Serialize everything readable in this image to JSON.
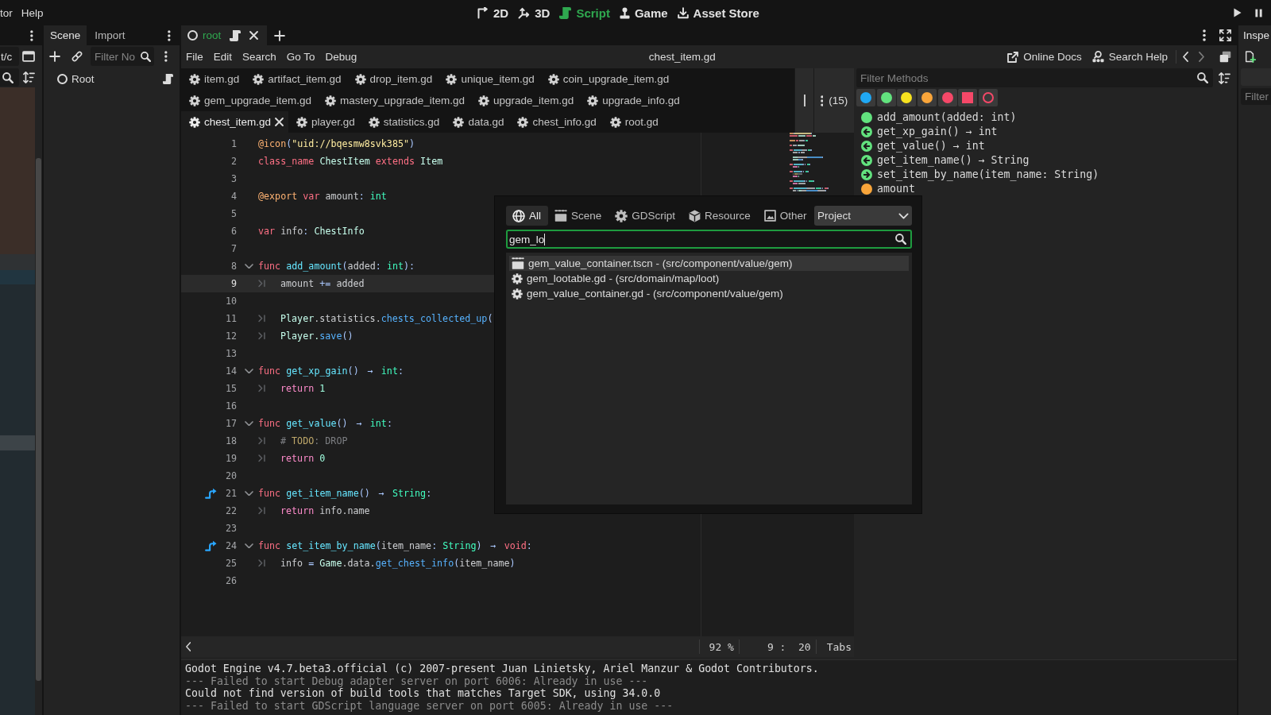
{
  "top_bar": {
    "menu": [
      "tor",
      "Help"
    ],
    "main_screens": [
      {
        "label": "2D",
        "selected": false
      },
      {
        "label": "3D",
        "selected": false
      },
      {
        "label": "Script",
        "selected": true
      },
      {
        "label": "Game",
        "selected": false
      },
      {
        "label": "Asset Store",
        "selected": false
      }
    ]
  },
  "filesystem_dock": {
    "path": "t/c"
  },
  "scene_dock": {
    "tabs": [
      {
        "label": "Scene",
        "selected": true
      },
      {
        "label": "Import",
        "selected": false
      }
    ],
    "filter": {
      "placeholder": "Filter No"
    },
    "tree": [
      {
        "label": "Root",
        "script_attached": true
      }
    ]
  },
  "scene_tabs": [
    {
      "label": "root",
      "selected": true,
      "script_attached": true
    }
  ],
  "script_editor": {
    "menu": [
      "File",
      "Edit",
      "Search",
      "Go To",
      "Debug"
    ],
    "title": "chest_item.gd",
    "help_links": [
      "Online Docs",
      "Search Help"
    ],
    "script_tab_rows": [
      [
        {
          "label": "item.gd",
          "selected": false
        },
        {
          "label": "artifact_item.gd",
          "selected": false
        },
        {
          "label": "drop_item.gd",
          "selected": false
        },
        {
          "label": "unique_item.gd",
          "selected": false
        },
        {
          "label": "coin_upgrade_item.gd",
          "selected": false
        }
      ],
      [
        {
          "label": "gem_upgrade_item.gd",
          "selected": false
        },
        {
          "label": "mastery_upgrade_item.gd",
          "selected": false
        },
        {
          "label": "upgrade_item.gd",
          "selected": false
        },
        {
          "label": "upgrade_info.gd",
          "selected": false
        }
      ],
      [
        {
          "label": "chest_item.gd",
          "selected": true
        },
        {
          "label": "player.gd",
          "selected": false
        },
        {
          "label": "statistics.gd",
          "selected": false
        },
        {
          "label": "data.gd",
          "selected": false
        },
        {
          "label": "chest_info.gd",
          "selected": false
        },
        {
          "label": "root.gd",
          "selected": false
        }
      ]
    ],
    "tab_count": "(15)",
    "code_lines": [
      {
        "number": "1",
        "indented": false,
        "foldable": false,
        "override": false,
        "current": false,
        "tokens": [
          {
            "kind": "annotation",
            "text": "@icon"
          },
          {
            "kind": "symbol",
            "text": "("
          },
          {
            "kind": "string",
            "text": "\"uid://bqesmw8svk385\""
          },
          {
            "kind": "symbol",
            "text": ")"
          }
        ]
      },
      {
        "number": "2",
        "indented": false,
        "foldable": false,
        "override": false,
        "current": false,
        "tokens": [
          {
            "kind": "keyword",
            "text": "class_name"
          },
          {
            "kind": "class",
            "text": " ChestItem"
          },
          {
            "kind": "keyword",
            "text": " extends"
          },
          {
            "kind": "class",
            "text": " Item"
          }
        ]
      },
      {
        "number": "3",
        "indented": false,
        "foldable": false,
        "override": false,
        "current": false
      },
      {
        "number": "4",
        "indented": false,
        "foldable": false,
        "override": false,
        "current": false,
        "tokens": [
          {
            "kind": "annotation",
            "text": "@export"
          },
          {
            "kind": "keyword",
            "text": " var"
          },
          {
            "kind": "text",
            "text": " amount"
          },
          {
            "kind": "symbol",
            "text": ": "
          },
          {
            "kind": "type",
            "text": "int"
          }
        ]
      },
      {
        "number": "5",
        "indented": false,
        "foldable": false,
        "override": false,
        "current": false
      },
      {
        "number": "6",
        "indented": false,
        "foldable": false,
        "override": false,
        "current": false,
        "tokens": [
          {
            "kind": "keyword",
            "text": "var"
          },
          {
            "kind": "text",
            "text": " info"
          },
          {
            "kind": "symbol",
            "text": ": "
          },
          {
            "kind": "class",
            "text": "ChestInfo"
          }
        ]
      },
      {
        "number": "7",
        "indented": false,
        "foldable": false,
        "override": false,
        "current": false
      },
      {
        "number": "8",
        "indented": false,
        "foldable": true,
        "override": false,
        "current": false,
        "tokens": [
          {
            "kind": "keyword",
            "text": "func"
          },
          {
            "kind": "function",
            "text": " add_amount"
          },
          {
            "kind": "symbol",
            "text": "("
          },
          {
            "kind": "text",
            "text": "added"
          },
          {
            "kind": "symbol",
            "text": ": "
          },
          {
            "kind": "type",
            "text": "int"
          },
          {
            "kind": "symbol",
            "text": "):"
          }
        ]
      },
      {
        "number": "9",
        "indented": true,
        "foldable": false,
        "override": false,
        "current": true,
        "tokens": [
          {
            "kind": "text",
            "text": "amount "
          },
          {
            "kind": "symbol",
            "text": "+="
          },
          {
            "kind": "text",
            "text": " added"
          }
        ]
      },
      {
        "number": "10",
        "indented": false,
        "foldable": false,
        "override": false,
        "current": false
      },
      {
        "number": "11",
        "indented": true,
        "foldable": false,
        "override": false,
        "current": false,
        "tokens": [
          {
            "kind": "class",
            "text": "Player"
          },
          {
            "kind": "text",
            "text": ".statistics."
          },
          {
            "kind": "call",
            "text": "chests_collected_up"
          },
          {
            "kind": "symbol",
            "text": "("
          }
        ]
      },
      {
        "number": "12",
        "indented": true,
        "foldable": false,
        "override": false,
        "current": false,
        "tokens": [
          {
            "kind": "class",
            "text": "Player."
          },
          {
            "kind": "call",
            "text": "save"
          },
          {
            "kind": "symbol",
            "text": "()"
          }
        ]
      },
      {
        "number": "13",
        "indented": false,
        "foldable": false,
        "override": false,
        "current": false
      },
      {
        "number": "14",
        "indented": false,
        "foldable": true,
        "override": false,
        "current": false,
        "tokens": [
          {
            "kind": "keyword",
            "text": "func"
          },
          {
            "kind": "function",
            "text": " get_xp_gain"
          },
          {
            "kind": "symbol",
            "text": "() "
          },
          {
            "kind": "arrow",
            "text": "→"
          },
          {
            "kind": "type",
            "text": " int"
          },
          {
            "kind": "symbol",
            "text": ":"
          }
        ]
      },
      {
        "number": "15",
        "indented": true,
        "foldable": false,
        "override": false,
        "current": false,
        "tokens": [
          {
            "kind": "control",
            "text": "return"
          },
          {
            "kind": "number",
            "text": " 1"
          }
        ]
      },
      {
        "number": "16",
        "indented": false,
        "foldable": false,
        "override": false,
        "current": false
      },
      {
        "number": "17",
        "indented": false,
        "foldable": true,
        "override": false,
        "current": false,
        "tokens": [
          {
            "kind": "keyword",
            "text": "func"
          },
          {
            "kind": "function",
            "text": " get_value"
          },
          {
            "kind": "symbol",
            "text": "() "
          },
          {
            "kind": "arrow",
            "text": "→"
          },
          {
            "kind": "type",
            "text": " int"
          },
          {
            "kind": "symbol",
            "text": ":"
          }
        ]
      },
      {
        "number": "18",
        "indented": true,
        "foldable": false,
        "override": false,
        "current": false,
        "tokens": [
          {
            "kind": "comment",
            "text": "# "
          },
          {
            "kind": "todo",
            "text": "TODO"
          },
          {
            "kind": "comment",
            "text": ": DROP"
          }
        ]
      },
      {
        "number": "19",
        "indented": true,
        "foldable": false,
        "override": false,
        "current": false,
        "tokens": [
          {
            "kind": "control",
            "text": "return"
          },
          {
            "kind": "number",
            "text": " 0"
          }
        ]
      },
      {
        "number": "20",
        "indented": false,
        "foldable": false,
        "override": false,
        "current": false
      },
      {
        "number": "21",
        "indented": false,
        "foldable": true,
        "override": true,
        "current": false,
        "tokens": [
          {
            "kind": "keyword",
            "text": "func"
          },
          {
            "kind": "function",
            "text": " get_item_name"
          },
          {
            "kind": "symbol",
            "text": "() "
          },
          {
            "kind": "arrow",
            "text": "→"
          },
          {
            "kind": "type",
            "text": " String"
          },
          {
            "kind": "symbol",
            "text": ":"
          }
        ]
      },
      {
        "number": "22",
        "indented": true,
        "foldable": false,
        "override": false,
        "current": false,
        "tokens": [
          {
            "kind": "control",
            "text": "return"
          },
          {
            "kind": "text",
            "text": " info.name"
          }
        ]
      },
      {
        "number": "23",
        "indented": false,
        "foldable": false,
        "override": false,
        "current": false
      },
      {
        "number": "24",
        "indented": false,
        "foldable": true,
        "override": true,
        "current": false,
        "tokens": [
          {
            "kind": "keyword",
            "text": "func"
          },
          {
            "kind": "function",
            "text": " set_item_by_name"
          },
          {
            "kind": "symbol",
            "text": "("
          },
          {
            "kind": "text",
            "text": "item_name"
          },
          {
            "kind": "symbol",
            "text": ": "
          },
          {
            "kind": "type",
            "text": "String"
          },
          {
            "kind": "symbol",
            "text": ") "
          },
          {
            "kind": "arrow",
            "text": "→"
          },
          {
            "kind": "keyword",
            "text": " void"
          },
          {
            "kind": "symbol",
            "text": ":"
          }
        ]
      },
      {
        "number": "25",
        "indented": true,
        "foldable": false,
        "override": false,
        "current": false,
        "tokens": [
          {
            "kind": "text",
            "text": "info "
          },
          {
            "kind": "symbol",
            "text": "="
          },
          {
            "kind": "class",
            "text": " Game"
          },
          {
            "kind": "text",
            "text": ".data."
          },
          {
            "kind": "call",
            "text": "get_chest_info"
          },
          {
            "kind": "symbol",
            "text": "("
          },
          {
            "kind": "text",
            "text": "item_name"
          },
          {
            "kind": "symbol",
            "text": ")"
          }
        ]
      },
      {
        "number": "26",
        "indented": false,
        "foldable": false,
        "override": false,
        "current": false
      }
    ],
    "zoom": "92 %",
    "cursor": "9 :  20",
    "indentation": "Tabs"
  },
  "methods_panel": {
    "filter": {
      "placeholder": "Filter Methods"
    },
    "color_filters": [
      {
        "kind": "circle",
        "color": "#20a8f4"
      },
      {
        "kind": "circle",
        "color": "#62e27e"
      },
      {
        "kind": "circle",
        "color": "#f7e21f"
      },
      {
        "kind": "circle",
        "color": "#f9a53a"
      },
      {
        "kind": "circle",
        "color": "#f54868"
      },
      {
        "kind": "square",
        "color": "#f54868"
      },
      {
        "kind": "ring",
        "color": "#f54868"
      }
    ],
    "members": [
      {
        "label": "add_amount(added: int)",
        "kind": "plain",
        "color": "#62e27e"
      },
      {
        "label": "get_xp_gain() → int",
        "kind": "getter",
        "color": "#62e27e"
      },
      {
        "label": "get_value() → int",
        "kind": "getter",
        "color": "#62e27e"
      },
      {
        "label": "get_item_name() → String",
        "kind": "getter",
        "color": "#62e27e"
      },
      {
        "label": "set_item_by_name(item_name: String)",
        "kind": "setter",
        "color": "#62e27e"
      },
      {
        "label": "amount",
        "kind": "plain",
        "color": "#f9a53a"
      }
    ]
  },
  "output": [
    {
      "text": "Godot Engine v4.7.beta3.official (c) 2007-present Juan Linietsky, Ariel Manzur & Godot Contributors.",
      "dimmed": false
    },
    {
      "text": "--- Failed to start Debug adapter server on port 6006: Already in use ---",
      "dimmed": true
    },
    {
      "text": "Could not find version of build tools that matches Target SDK, using 34.0.0",
      "dimmed": false
    },
    {
      "text": "--- Failed to start GDScript language server on port 6005: Already in use ---",
      "dimmed": true
    }
  ],
  "inspector_dock": {
    "tab": "Inspe",
    "filter": {
      "placeholder": "Filter"
    }
  },
  "quick_open": {
    "filters": [
      {
        "label": "All",
        "selected": true
      },
      {
        "label": "Scene",
        "selected": false
      },
      {
        "label": "GDScript",
        "selected": false
      },
      {
        "label": "Resource",
        "selected": false
      },
      {
        "label": "Other",
        "selected": false
      }
    ],
    "scope": "Project",
    "search": {
      "value": "gem_lo"
    },
    "results": [
      {
        "label": "gem_value_container.tscn - (src/component/value/gem)",
        "kind": "scene",
        "selected": true
      },
      {
        "label": "gem_lootable.gd - (src/domain/map/loot)",
        "kind": "script",
        "selected": false
      },
      {
        "label": "gem_value_container.gd - (src/component/value/gem)",
        "kind": "script",
        "selected": false
      }
    ]
  }
}
